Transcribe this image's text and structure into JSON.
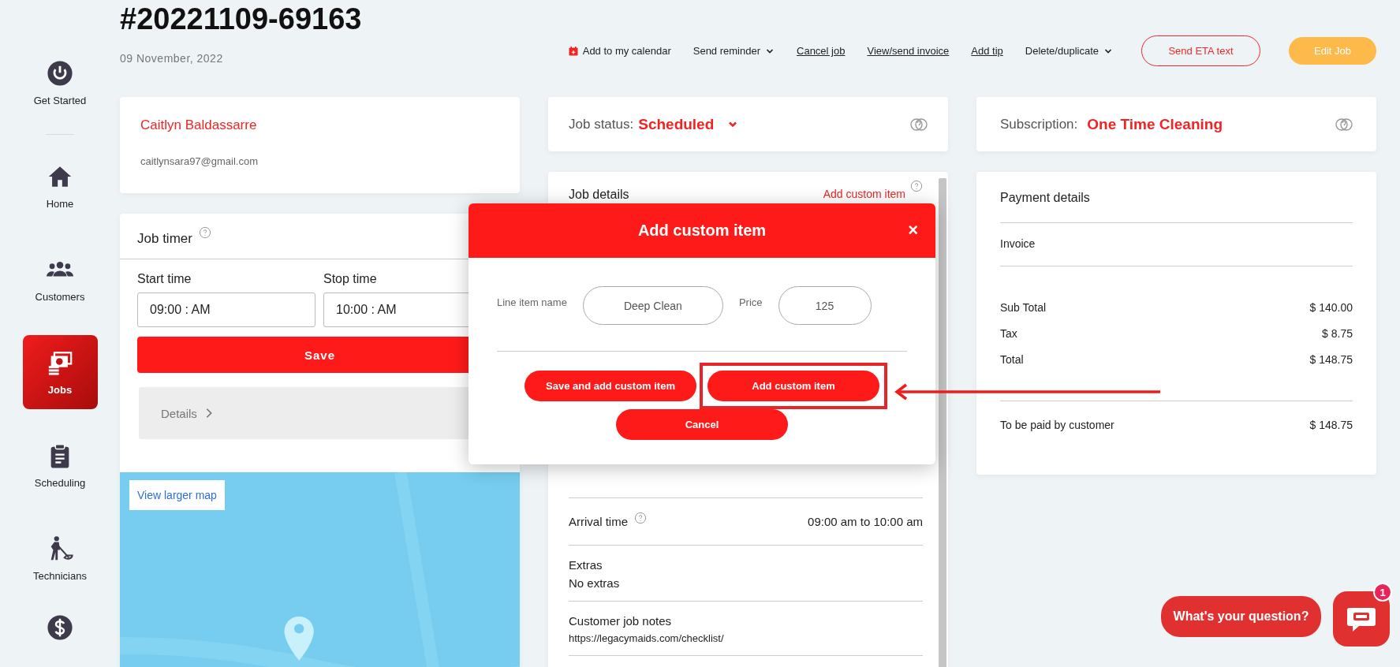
{
  "job": {
    "number": "#20221109-69163",
    "date": "09 November, 2022"
  },
  "actions": [
    {
      "label": "Add to my calendar",
      "kind": "calendar"
    },
    {
      "label": "Send reminder",
      "kind": "dropdown"
    },
    {
      "label": "Cancel job",
      "kind": "link"
    },
    {
      "label": "View/send invoice",
      "kind": "link"
    },
    {
      "label": "Add tip",
      "kind": "link"
    },
    {
      "label": "Delete/duplicate",
      "kind": "dropdown"
    },
    {
      "label": "Send ETA text",
      "kind": "outline"
    },
    {
      "label": "Edit Job",
      "kind": "primary"
    }
  ],
  "sidebar": {
    "items": [
      {
        "label": "Get Started",
        "selected": false
      },
      {
        "label": "Home",
        "selected": false
      },
      {
        "label": "Customers",
        "selected": false
      },
      {
        "label": "Jobs",
        "selected": true
      },
      {
        "label": "Scheduling",
        "selected": false
      },
      {
        "label": "Technicians",
        "selected": false
      }
    ]
  },
  "customer": {
    "name": "Caitlyn Baldassarre",
    "email": "caitlynsara97@gmail.com"
  },
  "job_timer": {
    "title": "Job timer",
    "start_label": "Start time",
    "start_value": "09:00 : AM",
    "stop_label": "Stop time",
    "stop_value": "10:00 : AM",
    "save": "Save",
    "details": "Details",
    "map_link": "View larger map"
  },
  "job_status": {
    "label": "Job status:",
    "value": "Scheduled"
  },
  "job_details": {
    "title": "Job details",
    "add_link": "Add custom item",
    "rows": [
      {
        "kind": "inline",
        "label": "Arrival time",
        "value": "09:00 am to 10:00 am",
        "help": true
      },
      {
        "kind": "stacked",
        "label": "Extras",
        "value": "No extras",
        "help": false
      },
      {
        "kind": "stacked",
        "label": "Customer job notes",
        "value": "https://legacymaids.com/checklist/",
        "help": false
      }
    ]
  },
  "subscription": {
    "label": "Subscription:",
    "value": "One Time Cleaning"
  },
  "payment": {
    "title": "Payment details",
    "invoice": "Invoice",
    "lines": [
      {
        "label": "Sub Total",
        "amount": "$ 140.00"
      },
      {
        "label": "Tax",
        "amount": "$ 8.75"
      },
      {
        "label": "Total",
        "amount": "$ 148.75"
      }
    ],
    "due": {
      "label": "To be paid by customer",
      "amount": "$ 148.75"
    }
  },
  "modal": {
    "title": "Add custom item",
    "close": "×",
    "fields": [
      {
        "label": "Line item name",
        "value": "Deep Clean"
      },
      {
        "label": "Price",
        "value": "125"
      }
    ],
    "buttons": [
      {
        "label": "Save and add custom item",
        "highlighted": false
      },
      {
        "label": "Add custom item",
        "highlighted": true
      },
      {
        "label": "Cancel",
        "highlighted": false
      }
    ]
  },
  "chat": {
    "prompt": "What's your question?",
    "badge": "1"
  }
}
